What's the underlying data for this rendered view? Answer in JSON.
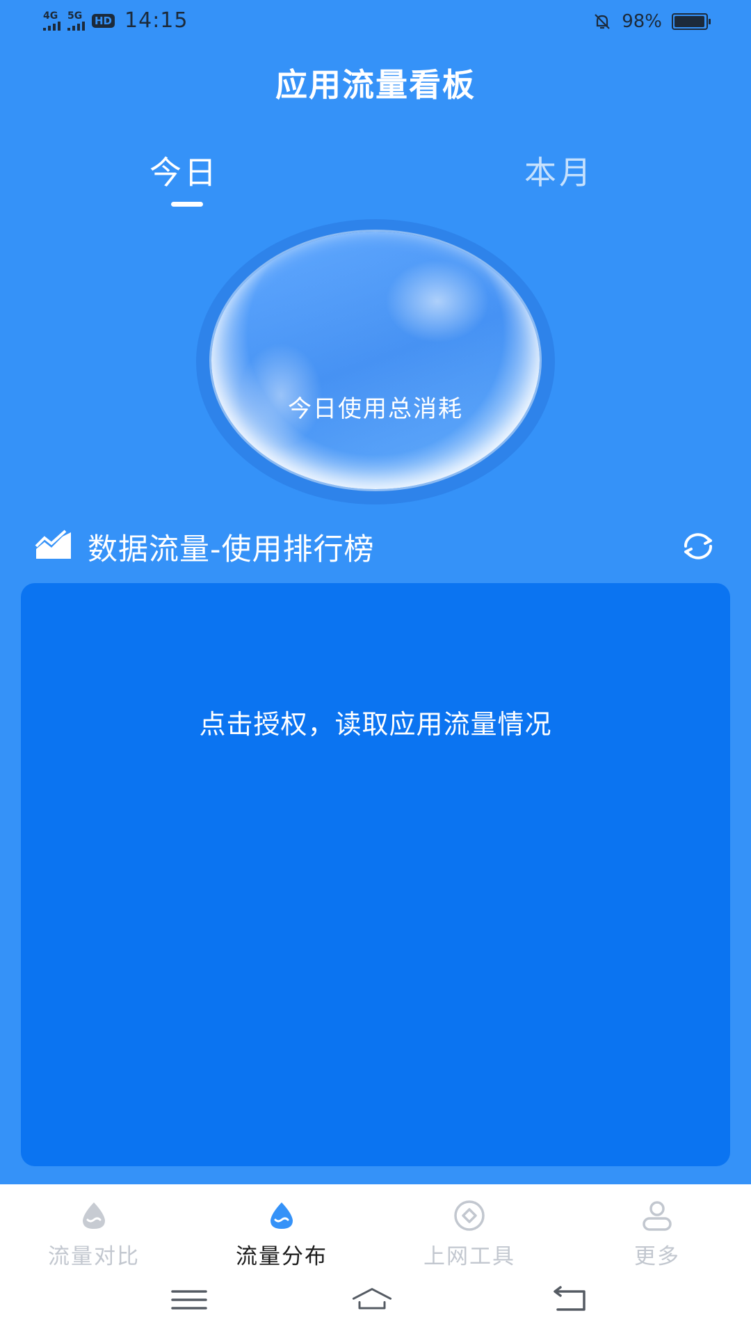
{
  "status_bar": {
    "network_1": "4G",
    "network_2": "5G",
    "hd_badge": "HD",
    "time": "14:15",
    "battery_text": "98%",
    "battery_level": 0.98,
    "icons": [
      "signal-icon",
      "signal-icon",
      "hd-icon",
      "mute-bell-icon",
      "battery-icon"
    ]
  },
  "header": {
    "title": "应用流量看板"
  },
  "tabs": [
    {
      "label": "今日",
      "active": true
    },
    {
      "label": "本月",
      "active": false
    }
  ],
  "bubble": {
    "label": "今日使用总消耗",
    "value": ""
  },
  "ranking": {
    "title": "数据流量-使用排行榜",
    "icon": "trend-chart-icon",
    "refresh_icon": "refresh-icon",
    "prompt": "点击授权，读取应用流量情况"
  },
  "bottom_nav": [
    {
      "label": "流量对比",
      "icon": "drop-icon",
      "active": false
    },
    {
      "label": "流量分布",
      "icon": "drop-icon",
      "active": true
    },
    {
      "label": "上网工具",
      "icon": "diamond-circle-icon",
      "active": false
    },
    {
      "label": "更多",
      "icon": "user-icon",
      "active": false
    }
  ],
  "system_nav": [
    "menu-icon",
    "home-icon",
    "back-icon"
  ],
  "colors": {
    "background": "#3592f8",
    "card": "#0b74f1",
    "accent": "#3592f8",
    "inactive": "#c2c7cf"
  }
}
